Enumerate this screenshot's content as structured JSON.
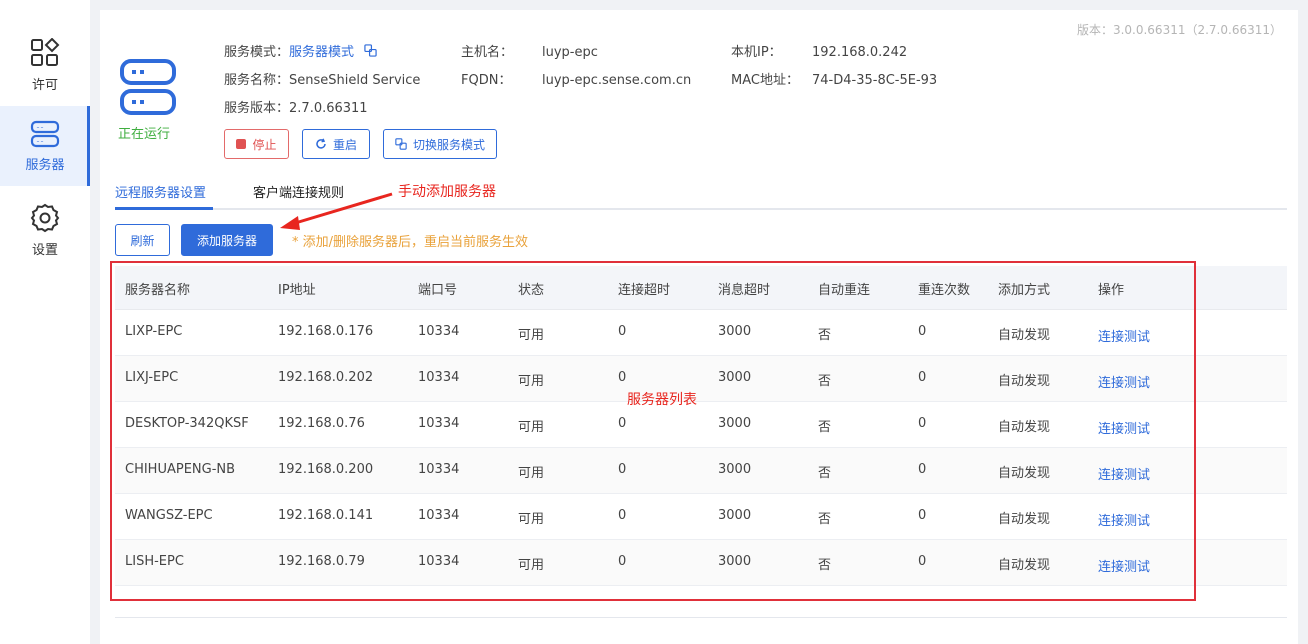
{
  "sidebar": {
    "items": [
      {
        "label": "许可",
        "icon": "license-grid-icon"
      },
      {
        "label": "服务器",
        "icon": "server-icon"
      },
      {
        "label": "设置",
        "icon": "gear-icon"
      }
    ]
  },
  "header": {
    "version": "版本：3.0.0.66311（2.7.0.66311）",
    "status": "正在运行",
    "mode_label": "服务模式：",
    "mode_value": "服务器模式",
    "name_label": "服务名称：",
    "name_value": "SenseShield Service",
    "svc_version_label": "服务版本：",
    "svc_version_value": "2.7.0.66311",
    "host_label": "主机名：",
    "host_value": "luyp-epc",
    "fqdn_label": "FQDN：",
    "fqdn_value": "luyp-epc.sense.com.cn",
    "ip_label": "本机IP：",
    "ip_value": "192.168.0.242",
    "mac_label": "MAC地址：",
    "mac_value": "74-D4-35-8C-5E-93",
    "buttons": {
      "stop": "停止",
      "restart": "重启",
      "switch": "切换服务模式"
    }
  },
  "tabs": [
    {
      "label": "远程服务器设置"
    },
    {
      "label": "客户端连接规则"
    }
  ],
  "toolbar": {
    "refresh": "刷新",
    "add": "添加服务器",
    "hint": "* 添加/删除服务器后，重启当前服务生效"
  },
  "annotations": {
    "add_manual": "手动添加服务器",
    "server_list": "服务器列表"
  },
  "table": {
    "columns": [
      "服务器名称",
      "IP地址",
      "端口号",
      "状态",
      "连接超时",
      "消息超时",
      "自动重连",
      "重连次数",
      "添加方式",
      "操作"
    ],
    "rows": [
      [
        "LIXP-EPC",
        "192.168.0.176",
        "10334",
        "可用",
        "0",
        "3000",
        "否",
        "0",
        "自动发现",
        "连接测试"
      ],
      [
        "LIXJ-EPC",
        "192.168.0.202",
        "10334",
        "可用",
        "0",
        "3000",
        "否",
        "0",
        "自动发现",
        "连接测试"
      ],
      [
        "DESKTOP-342QKSF",
        "192.168.0.76",
        "10334",
        "可用",
        "0",
        "3000",
        "否",
        "0",
        "自动发现",
        "连接测试"
      ],
      [
        "CHIHUAPENG-NB",
        "192.168.0.200",
        "10334",
        "可用",
        "0",
        "3000",
        "否",
        "0",
        "自动发现",
        "连接测试"
      ],
      [
        "WANGSZ-EPC",
        "192.168.0.141",
        "10334",
        "可用",
        "0",
        "3000",
        "否",
        "0",
        "自动发现",
        "连接测试"
      ],
      [
        "LISH-EPC",
        "192.168.0.79",
        "10334",
        "可用",
        "0",
        "3000",
        "否",
        "0",
        "自动发现",
        "连接测试"
      ]
    ]
  },
  "colors": {
    "accent": "#2f6bda",
    "running": "#3fae3f",
    "stop": "#e05252",
    "hint": "#e9a23b",
    "annotation": "#e8261f"
  }
}
